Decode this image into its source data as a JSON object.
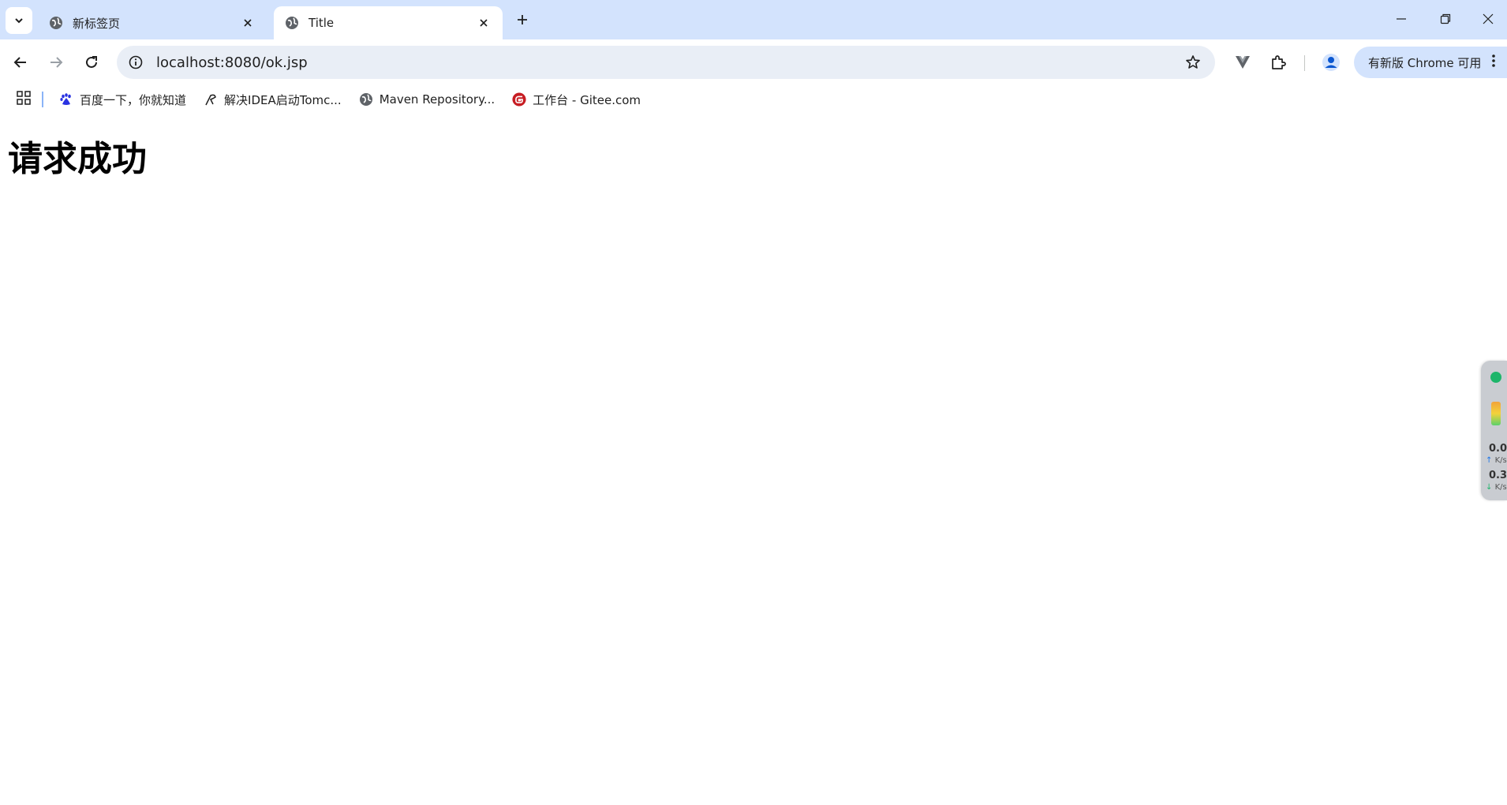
{
  "tabs": [
    {
      "title": "新标签页",
      "active": false
    },
    {
      "title": "Title",
      "active": true
    }
  ],
  "address_bar": {
    "url": "localhost:8080/ok.jsp"
  },
  "update_button": {
    "label": "有新版 Chrome 可用"
  },
  "bookmarks": [
    {
      "label": "百度一下，你就知道",
      "icon": "baidu-icon"
    },
    {
      "label": "解决IDEA启动Tomc...",
      "icon": "feather-icon"
    },
    {
      "label": "Maven Repository...",
      "icon": "globe-icon"
    },
    {
      "label": "工作台 - Gitee.com",
      "icon": "gitee-icon"
    }
  ],
  "page": {
    "heading": "请求成功"
  },
  "net_widget": {
    "up_value": "0.0",
    "up_unit": "K/s",
    "down_value": "0.3",
    "down_unit": "K/s"
  },
  "colors": {
    "tabstrip": "#d3e3fd",
    "omnibox": "#e9eef6",
    "gitee": "#c71d23",
    "baidu": "#2932e1",
    "widget_dot": "#1db56a"
  }
}
